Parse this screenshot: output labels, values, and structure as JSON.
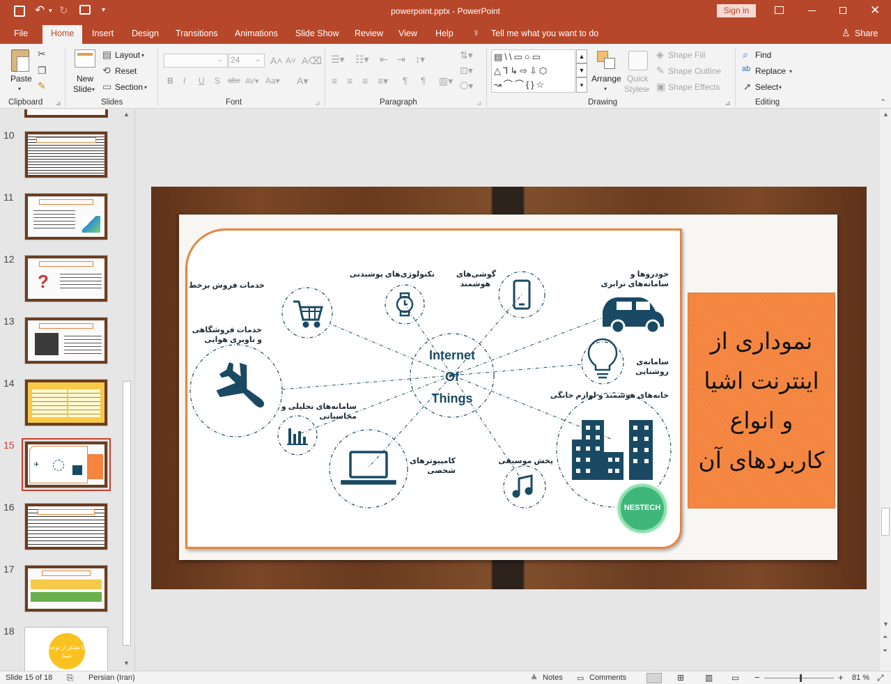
{
  "titlebar": {
    "doc_title": "powerpoint.pptx - PowerPoint",
    "sign_in": "Sign in"
  },
  "tabs": [
    "File",
    "Home",
    "Insert",
    "Design",
    "Transitions",
    "Animations",
    "Slide Show",
    "Review",
    "View",
    "Help"
  ],
  "tell_me": "Tell me what you want to do",
  "share": "Share",
  "ribbon": {
    "clipboard": {
      "label": "Clipboard",
      "paste": "Paste"
    },
    "slides": {
      "label": "Slides",
      "new_slide_1": "New",
      "new_slide_2": "Slide",
      "layout": "Layout",
      "reset": "Reset",
      "section": "Section"
    },
    "font": {
      "label": "Font",
      "size": "24"
    },
    "paragraph": {
      "label": "Paragraph"
    },
    "drawing": {
      "label": "Drawing",
      "arrange": "Arrange",
      "quick_styles_1": "Quick",
      "quick_styles_2": "Styles",
      "shape_fill": "Shape Fill",
      "shape_outline": "Shape Outline",
      "shape_effects": "Shape Effects"
    },
    "editing": {
      "label": "Editing",
      "find": "Find",
      "replace": "Replace",
      "select": "Select"
    }
  },
  "thumbnails": [
    {
      "num": "10"
    },
    {
      "num": "11"
    },
    {
      "num": "12"
    },
    {
      "num": "13"
    },
    {
      "num": "14"
    },
    {
      "num": "15",
      "selected": true
    },
    {
      "num": "16"
    },
    {
      "num": "17"
    },
    {
      "num": "18",
      "text": "با تشکر از توجه شما"
    }
  ],
  "slide": {
    "center_1": "Internet",
    "center_2": "Of",
    "center_3": "Things",
    "labels": {
      "ecommerce": "خدمات فروش برخط",
      "wearables": "تکنولوژی‌های پوشیدنی",
      "phones_1": "گوشی‌های",
      "phones_2": "هوشمند",
      "cars_1": "خودروها و",
      "cars_2": "سامانه‌های ترابری",
      "retail_1": "خدمات فروشگاهی",
      "retail_2": "و ناوبری هوایی",
      "lighting_1": "سامانه‌ی",
      "lighting_2": "روشنایی",
      "smarthome": "خانه‌های هوشمند و لوازم خانگی",
      "analytics_1": "سامانه‌های تحلیلی و",
      "analytics_2": "محاسباتی",
      "computers_1": "کامپیوترهای",
      "computers_2": "شخصی",
      "music": "پخش موسیقی"
    },
    "logo": "NESTECH",
    "title_lines": [
      "نموداری از",
      "اینترنت اشیا",
      "و انواع",
      "کاربردهای آن"
    ]
  },
  "status": {
    "slide_info": "Slide 15 of 18",
    "language": "Persian (Iran)",
    "notes": "Notes",
    "comments": "Comments",
    "zoom": "81 %"
  },
  "colors": {
    "accent": "#b7472a",
    "dark_teal": "#1a4a63",
    "orange_box": "#f5843e",
    "frame_orange": "#e8843e",
    "wood": "#6b3d21"
  }
}
